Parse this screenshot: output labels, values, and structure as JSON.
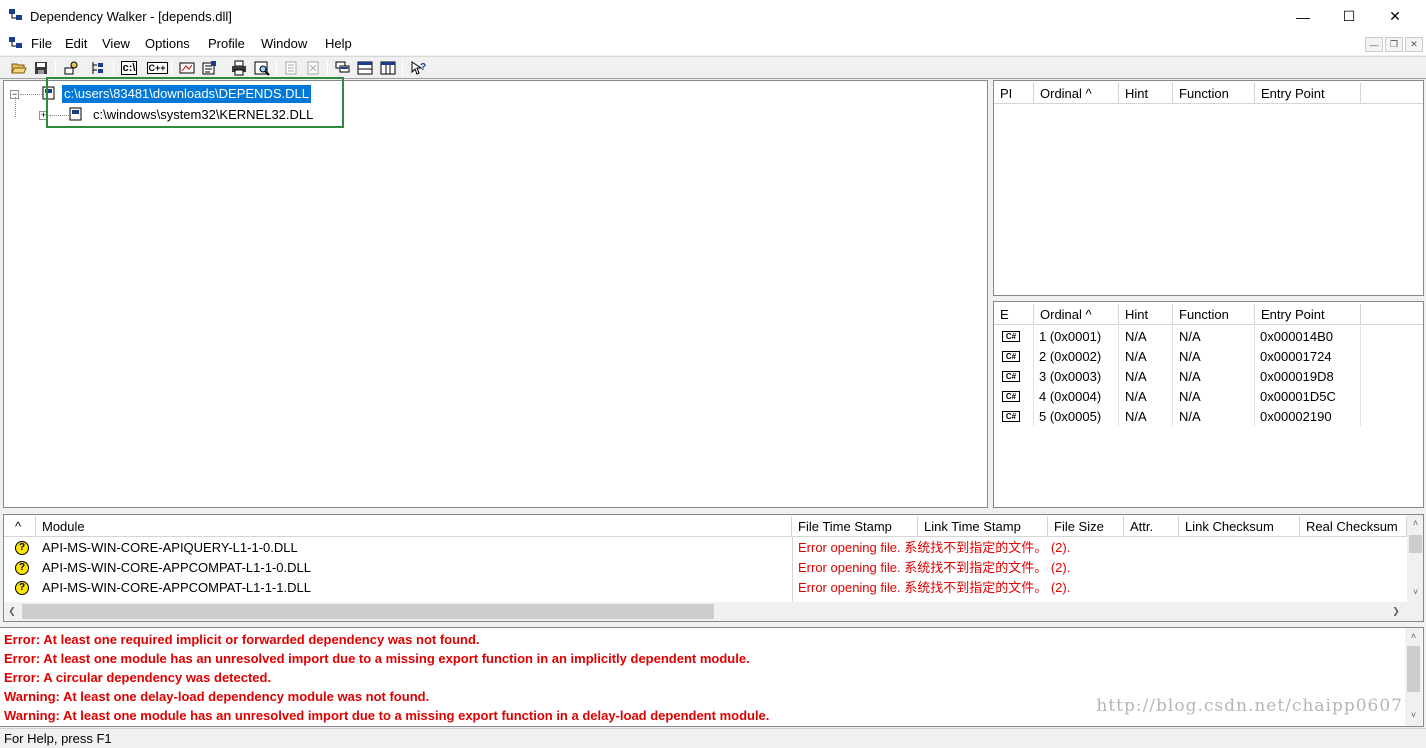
{
  "window": {
    "title": "Dependency Walker - [depends.dll]",
    "controls": [
      "minimize-icon",
      "maximize-icon",
      "close-icon"
    ]
  },
  "menu": {
    "items": [
      "File",
      "Edit",
      "View",
      "Options",
      "Profile",
      "Window",
      "Help"
    ]
  },
  "toolbar": {
    "buttons": [
      "open-icon",
      "save-icon",
      "copy-icon",
      "find-icon",
      "full-paths-icon",
      "undecorate-icon",
      "cpp-icon",
      "auto-expand-icon",
      "properties-icon",
      "print-icon",
      "view-module-icon",
      "expand-all-icon",
      "collapse-all-icon",
      "system-info-icon",
      "module-tree-icon",
      "module-list-icon",
      "split-icon",
      "help-icon"
    ],
    "text_buttons": {
      "paths": "c:\\",
      "cpp": "C++"
    }
  },
  "tree": {
    "nodes": [
      {
        "label": "c:\\users\\83481\\downloads\\DEPENDS.DLL",
        "expander": "−",
        "selected": true
      },
      {
        "label": "c:\\windows\\system32\\KERNEL32.DLL",
        "expander": "+",
        "selected": false
      }
    ]
  },
  "imports_table": {
    "columns": [
      "PI",
      "Ordinal ^",
      "Hint",
      "Function",
      "Entry Point"
    ],
    "rows": []
  },
  "exports_table": {
    "columns": [
      "E",
      "Ordinal ^",
      "Hint",
      "Function",
      "Entry Point"
    ],
    "icon_label": "C#",
    "rows": [
      {
        "ordinal": "1 (0x0001)",
        "hint": "N/A",
        "function": "N/A",
        "entry": "0x000014B0"
      },
      {
        "ordinal": "2 (0x0002)",
        "hint": "N/A",
        "function": "N/A",
        "entry": "0x00001724"
      },
      {
        "ordinal": "3 (0x0003)",
        "hint": "N/A",
        "function": "N/A",
        "entry": "0x000019D8"
      },
      {
        "ordinal": "4 (0x0004)",
        "hint": "N/A",
        "function": "N/A",
        "entry": "0x00001D5C"
      },
      {
        "ordinal": "5 (0x0005)",
        "hint": "N/A",
        "function": "N/A",
        "entry": "0x00002190"
      }
    ]
  },
  "module_list": {
    "columns": [
      "^",
      "Module",
      "File Time Stamp",
      "Link Time Stamp",
      "File Size",
      "Attr.",
      "Link Checksum",
      "Real Checksum"
    ],
    "warn_glyph": "?",
    "rows": [
      {
        "module": "API-MS-WIN-CORE-APIQUERY-L1-1-0.DLL",
        "status": "Error opening file. 系统找不到指定的文件。 (2)."
      },
      {
        "module": "API-MS-WIN-CORE-APPCOMPAT-L1-1-0.DLL",
        "status": "Error opening file. 系统找不到指定的文件。 (2)."
      },
      {
        "module": "API-MS-WIN-CORE-APPCOMPAT-L1-1-1.DLL",
        "status": "Error opening file. 系统找不到指定的文件。 (2)."
      }
    ]
  },
  "log": {
    "lines": [
      "Error: At least one required implicit or forwarded dependency was not found.",
      "Error: At least one module has an unresolved import due to a missing export function in an implicitly dependent module.",
      "Error: A circular dependency was detected.",
      "Warning: At least one delay-load dependency module was not found.",
      "Warning: At least one module has an unresolved import due to a missing export function in a delay-load dependent module."
    ],
    "watermark": "http://blog.csdn.net/chaipp0607"
  },
  "status": {
    "text": "For Help, press F1"
  },
  "colors": {
    "selection": "#0078d7",
    "error_red": "#e00000",
    "highlight_green": "#2e8b3c",
    "warning_yellow": "#ffe400"
  }
}
